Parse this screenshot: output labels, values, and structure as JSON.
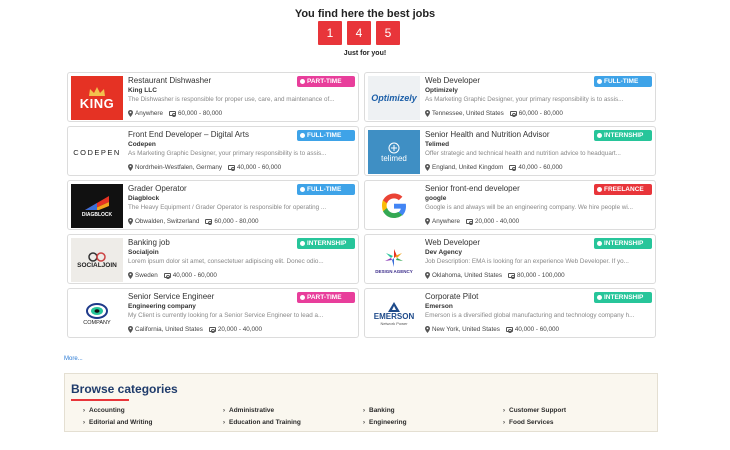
{
  "hero": {
    "title": "You find here the best jobs",
    "digits": [
      "1",
      "4",
      "5"
    ],
    "subtitle": "Just for you!"
  },
  "colors": {
    "accent": "#e8353a",
    "part_time": "#e83e9b",
    "full_time": "#3ea3e8",
    "internship": "#27c59a",
    "freelance": "#e8353a",
    "heading": "#1f3b6b"
  },
  "jobs": [
    {
      "title": "Restaurant Dishwasher",
      "company": "King LLC",
      "description": "The Dishwasher is responsible for proper use, care, and maintenance of...",
      "location": "Anywhere",
      "salary": "60,000 - 80,000",
      "type": "PART-TIME",
      "logo_text": "KING",
      "logo_icon": "crown-icon"
    },
    {
      "title": "Web Developer",
      "company": "Optimizely",
      "description": "As Marketing Graphic Designer, your primary responsibility is to assis...",
      "location": "Tennessee, United States",
      "salary": "60,000 - 80,000",
      "type": "FULL-TIME",
      "logo_text": "Optimizely",
      "logo_icon": "optimizely-logo"
    },
    {
      "title": "Front End Developer – Digital Arts",
      "company": "Codepen",
      "description": "As Marketing Graphic Designer, your primary responsibility is to assis...",
      "location": "Nordrhein-Westfalen, Germany",
      "salary": "40,000 - 60,000",
      "type": "FULL-TIME",
      "logo_text": "CODEPEN",
      "logo_icon": "codepen-logo"
    },
    {
      "title": "Senior Health and Nutrition Advisor",
      "company": "Telimed",
      "description": "Offer strategic and technical health and nutrition advice to headquart...",
      "location": "England, United Kingdom",
      "salary": "40,000 - 60,000",
      "type": "INTERNSHIP",
      "logo_text": "telimed",
      "logo_icon": "telimed-logo"
    },
    {
      "title": "Grader Operator",
      "company": "Diagblock",
      "description": "The Heavy Equipment / Grader Operator is responsible for operating ...",
      "location": "Obwalden, Switzerland",
      "salary": "60,000 - 80,000",
      "type": "FULL-TIME",
      "logo_text": "DIAGBLOCK",
      "logo_icon": "diagblock-logo"
    },
    {
      "title": "Senior front-end developer",
      "company": "google",
      "description": "Google is and always will be an engineering company. We hire people wi...",
      "location": "Anywhere",
      "salary": "20,000 - 40,000",
      "type": "FREELANCE",
      "logo_text": "",
      "logo_icon": "google-logo"
    },
    {
      "title": "Banking job",
      "company": "Socialjoin",
      "description": "Lorem ipsum dolor sit amet, consectetuer adipiscing elit. Donec odio...",
      "location": "Sweden",
      "salary": "40,000 - 60,000",
      "type": "INTERNSHIP",
      "logo_text": "SOCIALJOIN",
      "logo_icon": "socialjoin-logo"
    },
    {
      "title": "Web Developer",
      "company": "Dev Agency",
      "description": "Job Description: EMA is looking for an experience Web Developer. If yo...",
      "location": "Oklahoma, United States",
      "salary": "80,000 - 100,000",
      "type": "INTERNSHIP",
      "logo_text": "DESIGN AGENCY",
      "logo_icon": "dev-agency-logo"
    },
    {
      "title": "Senior Service Engineer",
      "company": "Engineering company",
      "description": "My Client is currently looking for a Senior Service Engineer to lead a...",
      "location": "California, United States",
      "salary": "20,000 - 40,000",
      "type": "PART-TIME",
      "logo_text": "COMPANY",
      "logo_icon": "engineering-company-logo"
    },
    {
      "title": "Corporate Pilot",
      "company": "Emerson",
      "description": "Emerson is a diversified global manufacturing and technology company h...",
      "location": "New York, United States",
      "salary": "40,000 - 60,000",
      "type": "INTERNSHIP",
      "logo_text": "EMERSON",
      "logo_subtext": "Network Power",
      "logo_icon": "emerson-logo"
    }
  ],
  "more_link": "More...",
  "categories": {
    "title": "Browse categories",
    "items": [
      "Accounting",
      "Administrative",
      "Banking",
      "Customer Support",
      "Editorial and Writing",
      "Education and Training",
      "Engineering",
      "Food Services"
    ]
  }
}
